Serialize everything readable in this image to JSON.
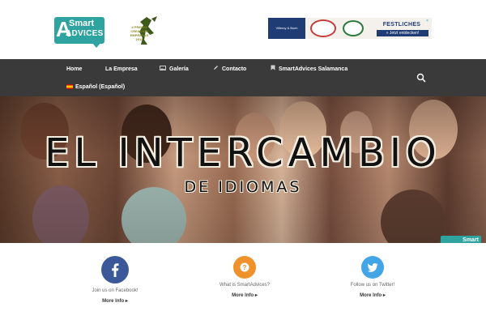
{
  "header": {
    "logo": {
      "letter": "A",
      "word1": "Smart",
      "word2": "ADVICES"
    },
    "award": {
      "text": "II PREMIO CREACIÓN EMPRESAS 2013"
    },
    "ad": {
      "brand": "Villeroy & Boch",
      "headline": "FESTLICHES",
      "cta": "» Jetzt entdecken!"
    }
  },
  "nav": {
    "items": [
      {
        "label": "Home",
        "icon": ""
      },
      {
        "label": "La Empresa",
        "icon": ""
      },
      {
        "label": "Galería",
        "icon": "image-icon"
      },
      {
        "label": "Contacto",
        "icon": "pencil-icon"
      },
      {
        "label": "SmartAdvices Salamanca",
        "icon": "bookmark-icon"
      }
    ],
    "language": "Español (Español)",
    "search_icon": "search-icon"
  },
  "hero": {
    "title": "EL INTERCAMBIO",
    "subtitle": "DE IDIOMAS",
    "badge": "Smart"
  },
  "features": [
    {
      "icon": "facebook-icon",
      "color": "#3b5998",
      "text": "Join us on Facebook!",
      "more": "More Info"
    },
    {
      "icon": "question-icon",
      "color": "#f0922b",
      "text": "What is SmartAdvices?",
      "more": "More Info"
    },
    {
      "icon": "twitter-icon",
      "color": "#44a5e6",
      "text": "Follow us on Twitter!",
      "more": "More Info"
    }
  ],
  "colors": {
    "brand_teal": "#2fa3a0",
    "nav_bg": "#3a3a3a"
  }
}
